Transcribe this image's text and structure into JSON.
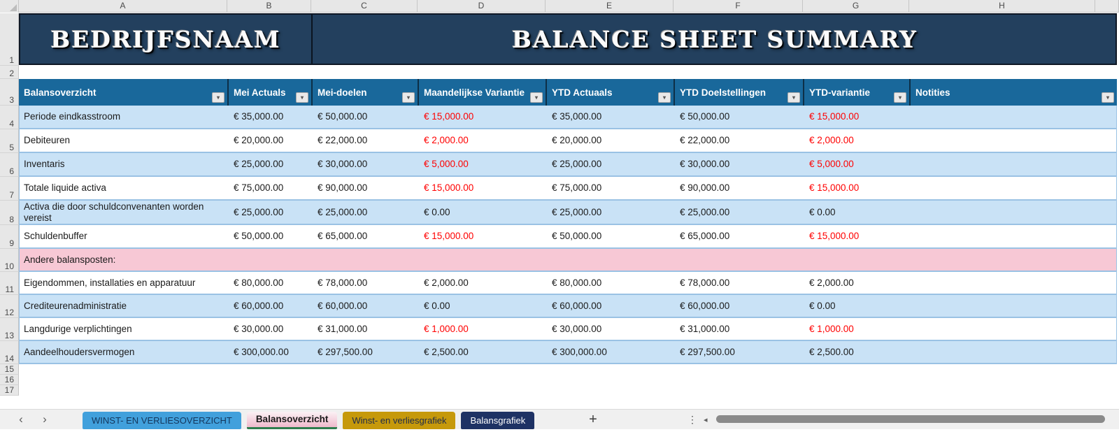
{
  "banner": {
    "company_name": "BEDRIJFSNAAM",
    "sheet_title": "BALANCE SHEET SUMMARY",
    "bg_color": "#23405E"
  },
  "grid": {
    "column_letters": [
      "A",
      "B",
      "C",
      "D",
      "E",
      "F",
      "G",
      "H"
    ],
    "row_numbers": [
      "1",
      "2",
      "3",
      "4",
      "5",
      "6",
      "7",
      "8",
      "9",
      "10",
      "11",
      "12",
      "13",
      "14",
      "15",
      "16",
      "17"
    ]
  },
  "table": {
    "columns": [
      "Balansoverzicht",
      "Mei Actuals",
      "Mei-doelen",
      "Maandelijkse Variantie",
      "YTD Actuaals",
      "YTD Doelstellingen",
      "YTD-variantie",
      "Notities"
    ],
    "filter_icon": "▾",
    "colors": {
      "header_bg": "#19689B",
      "alt_row_bg": "#C9E2F6",
      "section_row_bg": "#F7C8D5",
      "negative_text": "#FF0000",
      "row_border": "#9AC2E4"
    },
    "rows": [
      {
        "bg": "blue",
        "label": "Periode eindkasstroom",
        "cells": [
          {
            "t": "€ 35,000.00",
            "neg": false
          },
          {
            "t": "€ 50,000.00",
            "neg": false
          },
          {
            "t": "€ 15,000.00",
            "neg": true
          },
          {
            "t": "€ 35,000.00",
            "neg": false
          },
          {
            "t": "€ 50,000.00",
            "neg": false
          },
          {
            "t": "€ 15,000.00",
            "neg": true
          }
        ]
      },
      {
        "bg": "white",
        "label": "Debiteuren",
        "cells": [
          {
            "t": "€ 20,000.00",
            "neg": false
          },
          {
            "t": "€ 22,000.00",
            "neg": false
          },
          {
            "t": "€ 2,000.00",
            "neg": true
          },
          {
            "t": "€ 20,000.00",
            "neg": false
          },
          {
            "t": "€ 22,000.00",
            "neg": false
          },
          {
            "t": "€ 2,000.00",
            "neg": true
          }
        ]
      },
      {
        "bg": "blue",
        "label": "Inventaris",
        "cells": [
          {
            "t": "€ 25,000.00",
            "neg": false
          },
          {
            "t": "€ 30,000.00",
            "neg": false
          },
          {
            "t": "€ 5,000.00",
            "neg": true
          },
          {
            "t": "€ 25,000.00",
            "neg": false
          },
          {
            "t": "€ 30,000.00",
            "neg": false
          },
          {
            "t": "€ 5,000.00",
            "neg": true
          }
        ]
      },
      {
        "bg": "white",
        "label": "Totale liquide activa",
        "cells": [
          {
            "t": "€ 75,000.00",
            "neg": false
          },
          {
            "t": "€ 90,000.00",
            "neg": false
          },
          {
            "t": "€ 15,000.00",
            "neg": true
          },
          {
            "t": "€ 75,000.00",
            "neg": false
          },
          {
            "t": "€ 90,000.00",
            "neg": false
          },
          {
            "t": "€ 15,000.00",
            "neg": true
          }
        ]
      },
      {
        "bg": "blue",
        "label": "Activa die door schuldconvenanten worden vereist",
        "cells": [
          {
            "t": "€ 25,000.00",
            "neg": false
          },
          {
            "t": "€ 25,000.00",
            "neg": false
          },
          {
            "t": "€ 0.00",
            "neg": false
          },
          {
            "t": "€ 25,000.00",
            "neg": false
          },
          {
            "t": "€ 25,000.00",
            "neg": false
          },
          {
            "t": "€ 0.00",
            "neg": false
          }
        ]
      },
      {
        "bg": "white",
        "label": "Schuldenbuffer",
        "cells": [
          {
            "t": "€ 50,000.00",
            "neg": false
          },
          {
            "t": "€ 65,000.00",
            "neg": false
          },
          {
            "t": "€ 15,000.00",
            "neg": true
          },
          {
            "t": "€ 50,000.00",
            "neg": false
          },
          {
            "t": "€ 65,000.00",
            "neg": false
          },
          {
            "t": "€ 15,000.00",
            "neg": true
          }
        ]
      },
      {
        "bg": "pink",
        "label": "Andere balansposten:",
        "cells": []
      },
      {
        "bg": "white",
        "label": "Eigendommen, installaties en apparatuur",
        "cells": [
          {
            "t": "€ 80,000.00",
            "neg": false
          },
          {
            "t": "€ 78,000.00",
            "neg": false
          },
          {
            "t": "€ 2,000.00",
            "neg": false
          },
          {
            "t": "€ 80,000.00",
            "neg": false
          },
          {
            "t": "€ 78,000.00",
            "neg": false
          },
          {
            "t": "€ 2,000.00",
            "neg": false
          }
        ]
      },
      {
        "bg": "blue",
        "label": "Crediteurenadministratie",
        "cells": [
          {
            "t": "€ 60,000.00",
            "neg": false
          },
          {
            "t": "€ 60,000.00",
            "neg": false
          },
          {
            "t": "€ 0.00",
            "neg": false
          },
          {
            "t": "€ 60,000.00",
            "neg": false
          },
          {
            "t": "€ 60,000.00",
            "neg": false
          },
          {
            "t": "€ 0.00",
            "neg": false
          }
        ]
      },
      {
        "bg": "white",
        "label": "Langdurige verplichtingen",
        "cells": [
          {
            "t": "€ 30,000.00",
            "neg": false
          },
          {
            "t": "€ 31,000.00",
            "neg": false
          },
          {
            "t": "€ 1,000.00",
            "neg": true
          },
          {
            "t": "€ 30,000.00",
            "neg": false
          },
          {
            "t": "€ 31,000.00",
            "neg": false
          },
          {
            "t": "€ 1,000.00",
            "neg": true
          }
        ]
      },
      {
        "bg": "blue",
        "label": "Aandeelhoudersvermogen",
        "cells": [
          {
            "t": "€ 300,000.00",
            "neg": false
          },
          {
            "t": "€ 297,500.00",
            "neg": false
          },
          {
            "t": "€ 2,500.00",
            "neg": false
          },
          {
            "t": "€ 300,000.00",
            "neg": false
          },
          {
            "t": "€ 297,500.00",
            "neg": false
          },
          {
            "t": "€ 2,500.00",
            "neg": false
          }
        ]
      }
    ]
  },
  "sheet_bar": {
    "nav_prev_icon": "‹",
    "nav_next_icon": "›",
    "tabs": [
      {
        "label": "WINST- EN VERLIESOVERZICHT",
        "bg": "#41A0DC",
        "fg": "#14365C",
        "active": false
      },
      {
        "label": "Balansoverzicht",
        "bg": "#F3C3D2",
        "fg": "#1a1a1a",
        "active": true
      },
      {
        "label": "Winst- en verliesgrafiek",
        "bg": "#C6990B",
        "fg": "#1E2B4A",
        "active": false
      },
      {
        "label": "Balansgrafiek",
        "bg": "#1E3264",
        "fg": "#FFFFFF",
        "active": false
      }
    ],
    "active_tab_underline": "#2E7D4E",
    "add_sheet_icon": "+",
    "more_icon": "⋮",
    "scroll_left_icon": "◂"
  }
}
